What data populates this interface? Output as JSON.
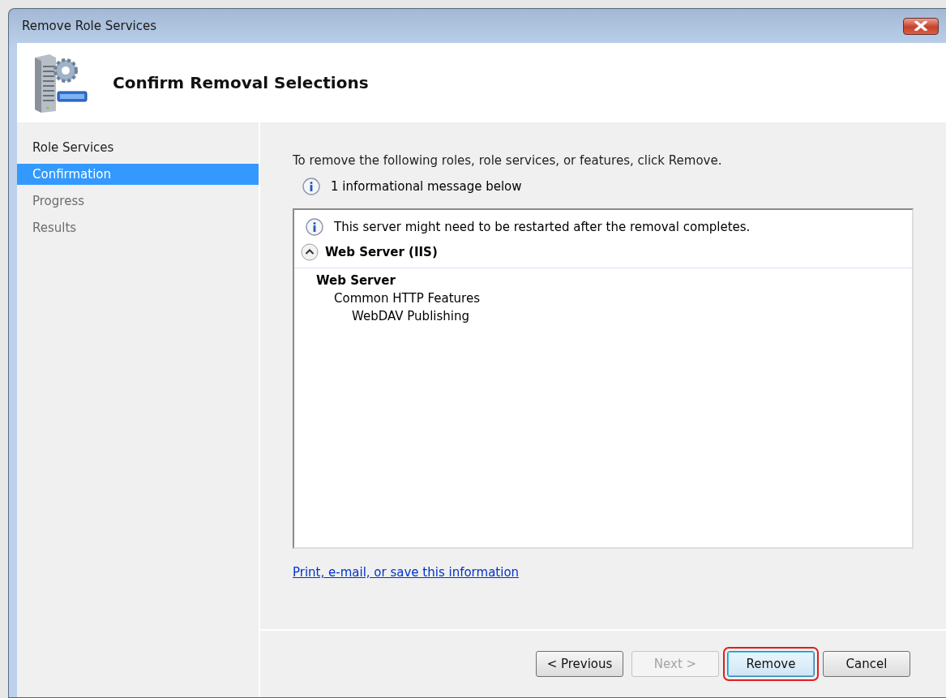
{
  "window": {
    "title": "Remove Role Services"
  },
  "header": {
    "title": "Confirm Removal Selections"
  },
  "sidebar": {
    "items": [
      {
        "label": "Role Services",
        "selected": false,
        "disabled": false
      },
      {
        "label": "Confirmation",
        "selected": true,
        "disabled": false
      },
      {
        "label": "Progress",
        "selected": false,
        "disabled": true
      },
      {
        "label": "Results",
        "selected": false,
        "disabled": true
      }
    ]
  },
  "content": {
    "instruction": "To remove the following roles, role services, or features, click Remove.",
    "message_summary": "1 informational message below",
    "details": {
      "message": "This server might need to be restarted after the removal completes.",
      "section": {
        "title": "Web Server (IIS)",
        "expanded": true,
        "tree": [
          {
            "label": "Web Server",
            "children": [
              {
                "label": "Common HTTP Features",
                "children": [
                  {
                    "label": "WebDAV Publishing"
                  }
                ]
              }
            ]
          }
        ]
      }
    },
    "link": "Print, e-mail, or save this information"
  },
  "buttons": [
    {
      "label": "< Previous",
      "disabled": false,
      "default": false,
      "highlighted": false
    },
    {
      "label": "Next >",
      "disabled": true,
      "default": false,
      "highlighted": false
    },
    {
      "label": "Remove",
      "disabled": false,
      "default": true,
      "highlighted": true
    },
    {
      "label": "Cancel",
      "disabled": false,
      "default": false,
      "highlighted": false
    }
  ]
}
